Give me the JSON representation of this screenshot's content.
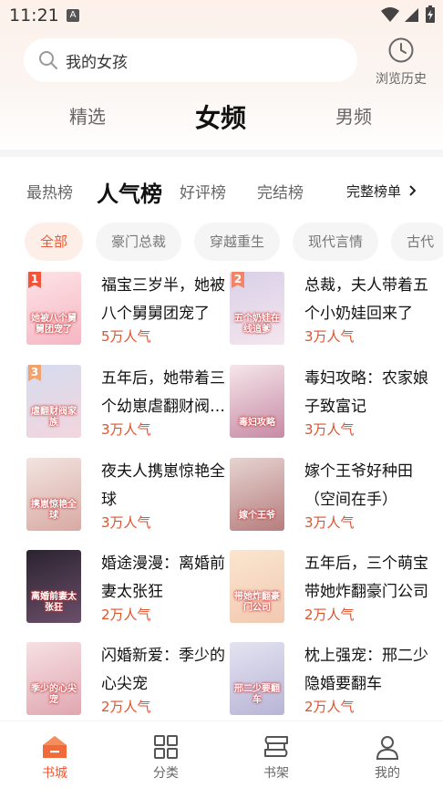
{
  "status_bar": {
    "time": "11:21",
    "notification_badge": "A"
  },
  "search": {
    "placeholder_text": "我的女孩",
    "history_label": "浏览历史"
  },
  "channel_tabs": [
    {
      "label": "精选",
      "active": false
    },
    {
      "label": "女频",
      "active": true
    },
    {
      "label": "男频",
      "active": false
    }
  ],
  "rank_tabs": [
    {
      "label": "最热榜",
      "active": false
    },
    {
      "label": "人气榜",
      "active": true
    },
    {
      "label": "好评榜",
      "active": false
    },
    {
      "label": "完结榜",
      "active": false
    }
  ],
  "full_list_label": "完整榜单",
  "categories": [
    {
      "label": "全部",
      "active": true
    },
    {
      "label": "豪门总裁",
      "active": false
    },
    {
      "label": "穿越重生",
      "active": false
    },
    {
      "label": "现代言情",
      "active": false
    },
    {
      "label": "古代",
      "active": false
    }
  ],
  "books": [
    {
      "rank": "1",
      "title": "福宝三岁半，她被八个舅舅团宠了",
      "popularity": "5万人气",
      "cover_text": "她被八个舅舅团宠了",
      "cover_colors": [
        "#fde3e6",
        "#f6b6c3"
      ]
    },
    {
      "rank": "2",
      "title": "总裁，夫人带着五个小奶娃回来了",
      "popularity": "3万人气",
      "cover_text": "五个奶娃在线追爹",
      "cover_colors": [
        "#d9d0e8",
        "#f4e6ee"
      ]
    },
    {
      "rank": "3",
      "title": "五年后，她带着三个幼崽虐翻财阀家族",
      "popularity": "3万人气",
      "cover_text": "虐翻财阀家族",
      "cover_colors": [
        "#d5dcef",
        "#f3d5dd"
      ]
    },
    {
      "rank": "",
      "title": "毒妇攻略：农家娘子致富记",
      "popularity": "3万人气",
      "cover_text": "毒妇攻略",
      "cover_colors": [
        "#f5e6ea",
        "#c78aa4"
      ]
    },
    {
      "rank": "",
      "title": "夜夫人携崽惊艳全球",
      "popularity": "3万人气",
      "cover_text": "携崽惊艳全球",
      "cover_colors": [
        "#f2e4e0",
        "#d9a9a3"
      ]
    },
    {
      "rank": "",
      "title": "嫁个王爷好种田（空间在手）",
      "popularity": "3万人气",
      "cover_text": "嫁个王爷",
      "cover_colors": [
        "#e5d4d2",
        "#b77d7d"
      ]
    },
    {
      "rank": "",
      "title": "婚途漫漫：离婚前妻太张狂",
      "popularity": "2万人气",
      "cover_text": "离婚前妻太张狂",
      "cover_colors": [
        "#2b2330",
        "#6b4f6a"
      ]
    },
    {
      "rank": "",
      "title": "五年后，三个萌宝带她炸翻豪门公司",
      "popularity": "2万人气",
      "cover_text": "带她炸翻豪门公司",
      "cover_colors": [
        "#fbe6ce",
        "#f2c8b2"
      ]
    },
    {
      "rank": "",
      "title": "闪婚新爱：季少的心尖宠",
      "popularity": "2万人气",
      "cover_text": "季少的心尖宠",
      "cover_colors": [
        "#f6e0e3",
        "#e0a6b0"
      ]
    },
    {
      "rank": "",
      "title": "枕上强宠：邢二少隐婚要翻车",
      "popularity": "2万人气",
      "cover_text": "邢二少要翻车",
      "cover_colors": [
        "#e4e3f1",
        "#b8b4d6"
      ]
    }
  ],
  "bottom_nav": [
    {
      "label": "书城",
      "active": true,
      "icon": "bookstore-icon"
    },
    {
      "label": "分类",
      "active": false,
      "icon": "category-grid-icon"
    },
    {
      "label": "书架",
      "active": false,
      "icon": "bookshelf-icon"
    },
    {
      "label": "我的",
      "active": false,
      "icon": "profile-icon"
    }
  ],
  "colors": {
    "accent": "#e85a38",
    "popularity": "#e0522c",
    "rank1": "#f0553a",
    "rank2": "#f1856a",
    "rank3": "#f2a26c"
  }
}
